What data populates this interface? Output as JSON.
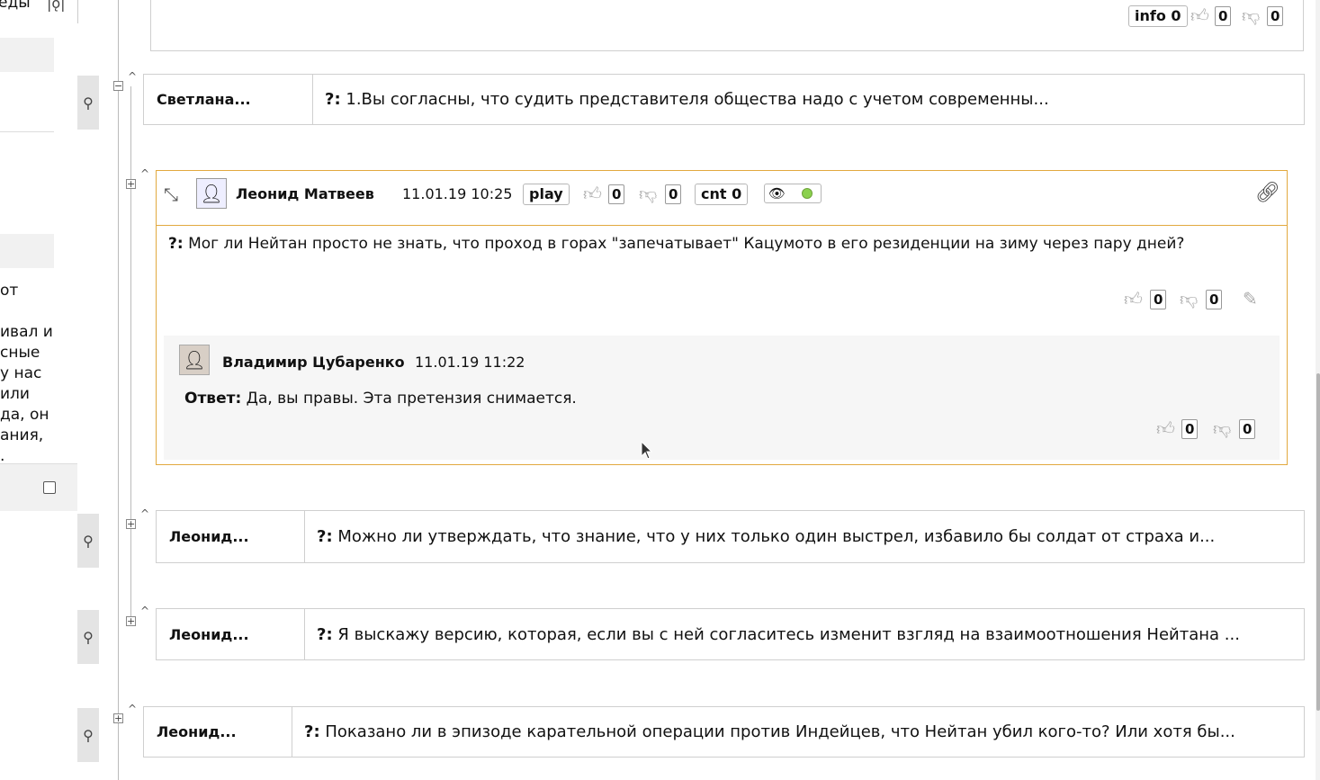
{
  "sidebar": {
    "top_text": "еды",
    "filter_icon": "filter-icon",
    "text_lines": [
      "от",
      "",
      "ивал и",
      "сные",
      "у нас",
      "или",
      "да, он",
      "ания,",
      "."
    ]
  },
  "top_card": {
    "info_label": "info 0",
    "likes": "0",
    "dislikes": "0"
  },
  "collapsed_rows": [
    {
      "author": "Светлана...",
      "prefix": "?:",
      "text": "1.Вы согласны, что судить представителя общества надо с учетом современны..."
    },
    {
      "author": "Леонид...",
      "prefix": "?:",
      "text": "Можно ли утверждать, что знание, что у них только один выстрел, избавило бы солдат от страха и..."
    },
    {
      "author": "Леонид...",
      "prefix": "?:",
      "text": "Я выскажу версию, которая, если вы с ней согласитесь изменит взгляд на взаимоотношения Нейтана ..."
    },
    {
      "author": "Леонид...",
      "prefix": "?:",
      "text": "Показано ли в эпизоде карательной операции против Индейцев, что Нейтан убил кого-то? Или хотя бы..."
    }
  ],
  "open_card": {
    "author": "Леонид Матвеев",
    "datetime": "11.01.19 10:25",
    "play_label": "play",
    "likes": "0",
    "dislikes": "0",
    "cnt_label": "cnt 0",
    "question_prefix": "?:",
    "question_text": "Мог ли Нейтан просто не знать, что проход в горах \"запечатывает\" Кацумото в его резиденции на зиму через пару дней?",
    "q_likes": "0",
    "q_dislikes": "0",
    "answer": {
      "author": "Владимир Цубаренко",
      "datetime": "11.01.19 11:22",
      "prefix": "Ответ:",
      "text": "Да, вы правы. Эта претензия снимается.",
      "likes": "0",
      "dislikes": "0"
    }
  }
}
